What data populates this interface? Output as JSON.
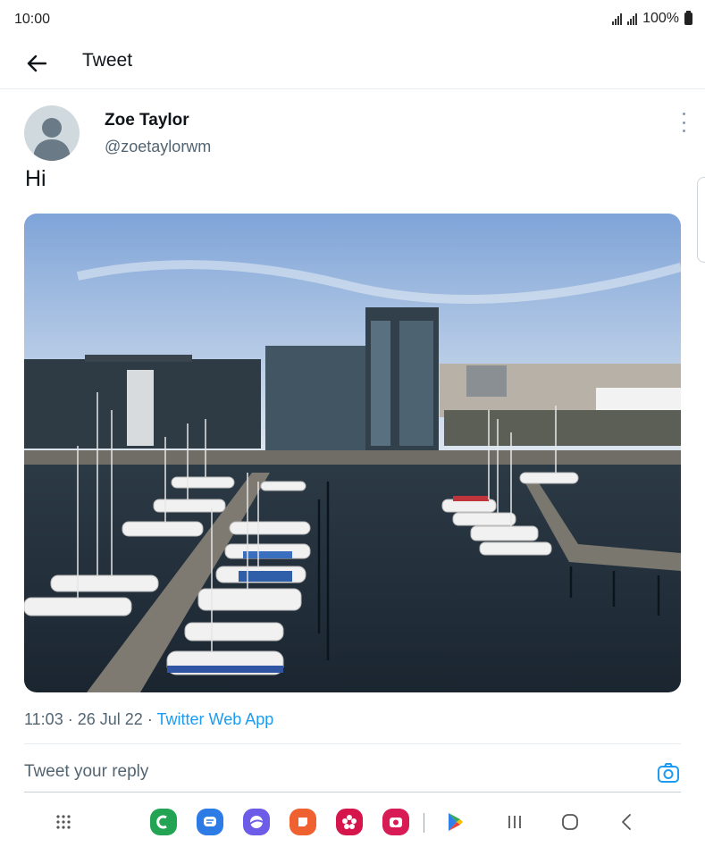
{
  "status_bar": {
    "time": "10:00",
    "battery": "100%"
  },
  "header": {
    "title": "Tweet"
  },
  "tweet": {
    "author_name": "Zoe Taylor",
    "author_handle": "@zoetaylorwm",
    "text": "Hi",
    "time": "11:03",
    "date": "26 Jul 22",
    "separator": "·",
    "source": "Twitter Web App"
  },
  "reply": {
    "placeholder": "Tweet your reply"
  },
  "nav_bar": {
    "apps": [
      {
        "name": "phone-app",
        "color": "#23a455"
      },
      {
        "name": "messages-app",
        "color": "#2d7be5"
      },
      {
        "name": "internet-app",
        "color": "#6c5ce7"
      },
      {
        "name": "notes-app",
        "color": "#f06131"
      },
      {
        "name": "blossom-app",
        "color": "#d5154c"
      },
      {
        "name": "camera-app",
        "color": "#d81a55"
      },
      {
        "name": "play-store-app",
        "color": "#34a853"
      }
    ]
  }
}
